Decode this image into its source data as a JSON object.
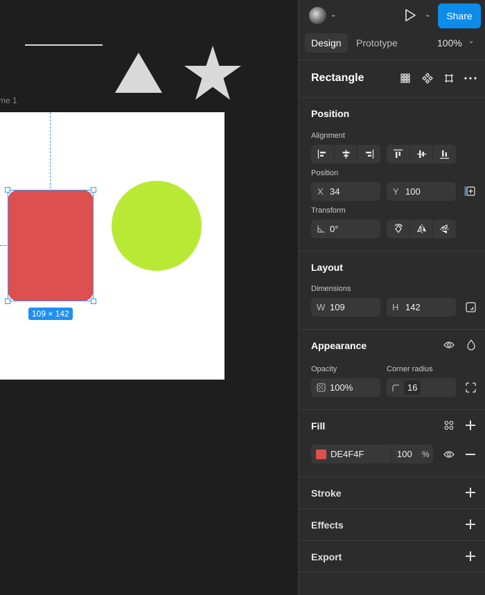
{
  "canvas": {
    "frame_label": "me 1",
    "selection_dimensions": "109 × 142",
    "colors": {
      "background": "#1e1e1e",
      "rect_fill": "#de4f4f",
      "circle_fill": "#b8ea35",
      "selection": "#2f9af7",
      "shape_gray": "#d9d9d9"
    }
  },
  "topbar": {
    "share_label": "Share",
    "avatar_icon": "avatar-icon",
    "play_icon": "play-icon"
  },
  "tabs": {
    "design": "Design",
    "prototype": "Prototype",
    "zoom": "100%"
  },
  "layer": {
    "name": "Rectangle"
  },
  "position_section": {
    "title": "Position",
    "alignment_label": "Alignment",
    "position_label": "Position",
    "x_prefix": "X",
    "x_value": "34",
    "y_prefix": "Y",
    "y_value": "100",
    "transform_label": "Transform",
    "rotation_value": "0°"
  },
  "layout_section": {
    "title": "Layout",
    "dimensions_label": "Dimensions",
    "w_prefix": "W",
    "w_value": "109",
    "h_prefix": "H",
    "h_value": "142"
  },
  "appearance_section": {
    "title": "Appearance",
    "opacity_label": "Opacity",
    "opacity_value": "100%",
    "radius_label": "Corner radius",
    "radius_value": "16"
  },
  "fill_section": {
    "title": "Fill",
    "hex": "DE4F4F",
    "opacity": "100",
    "percent": "%",
    "swatch_color": "#de4f4f"
  },
  "stroke_section": {
    "title": "Stroke"
  },
  "effects_section": {
    "title": "Effects"
  },
  "export_section": {
    "title": "Export"
  }
}
